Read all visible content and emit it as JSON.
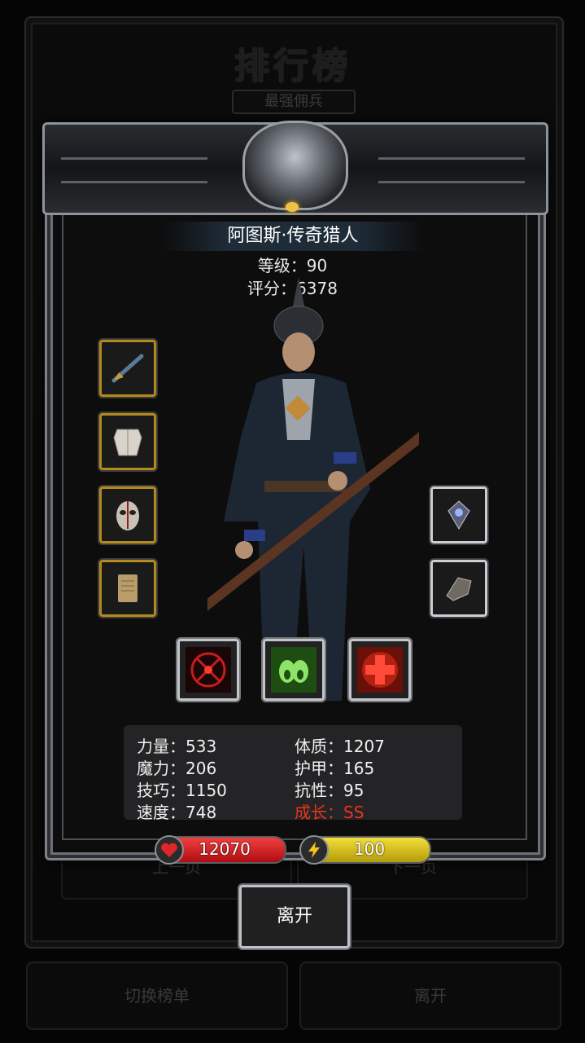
{
  "background": {
    "title": "排行榜",
    "subtitle": "最强佣兵",
    "prev_page": "上一页",
    "next_page": "下一页",
    "switch_list": "切换榜单",
    "leave": "离开"
  },
  "hero": {
    "name": "阿图斯·传奇猎人",
    "level_text": "等级：90",
    "score_text": "评分：6378"
  },
  "equipment": {
    "left": [
      "musket-icon",
      "armor-icon",
      "mask-icon",
      "scroll-icon"
    ],
    "right": [
      "emblem-icon",
      "gauntlet-icon"
    ]
  },
  "skills": [
    "crosshair-skill-icon",
    "poison-skill-icon",
    "heal-cross-skill-icon"
  ],
  "stats": {
    "strength": "力量：533",
    "magic": "魔力：206",
    "skill": "技巧：1150",
    "speed": "速度：748",
    "constitution": "体质：1207",
    "armor": "护甲：165",
    "resistance": "抗性：95",
    "growth": "成长：SS"
  },
  "bars": {
    "hp": "12070",
    "energy": "100"
  },
  "leave_button": "离开",
  "colors": {
    "gold_frame": "#b58a1c",
    "hp_red": "#d7161c",
    "energy_yellow": "#d8c21a",
    "growth_red": "#e9351b"
  }
}
